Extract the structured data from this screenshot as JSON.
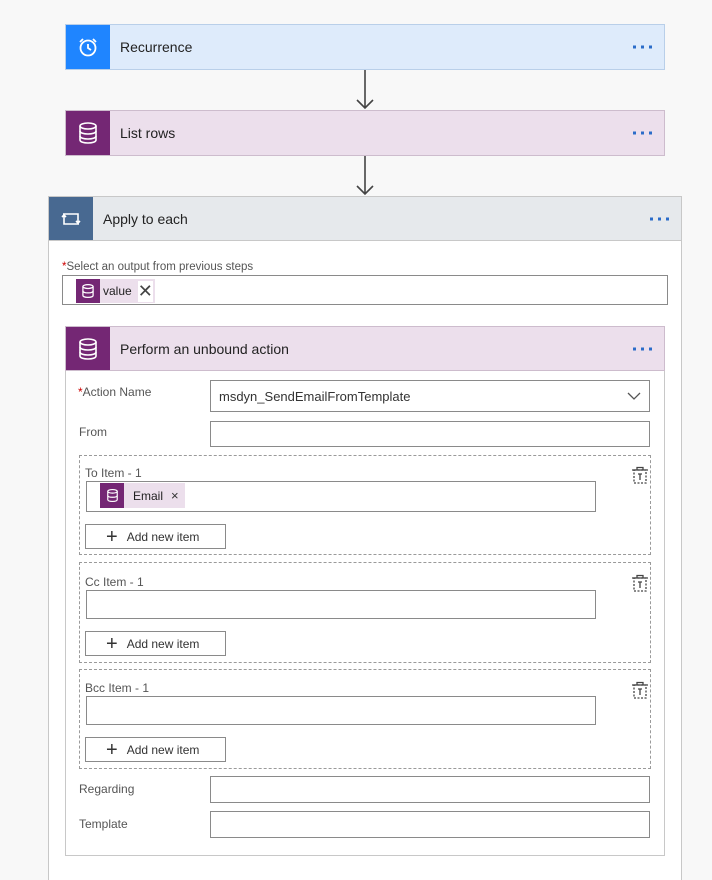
{
  "colors": {
    "recurrence_bg": "#deebfb",
    "recurrence_icon_bg": "#1f85ff",
    "dataverse_bg": "#ecdfec",
    "dataverse_icon_bg": "#742774",
    "loop_bg": "#e6e9ec",
    "loop_icon_bg": "#486991",
    "accent": "#2b6cc9"
  },
  "steps": {
    "recurrence": {
      "title": "Recurrence",
      "icon": "alarm-clock-icon"
    },
    "list_rows": {
      "title": "List rows",
      "icon": "database-icon"
    },
    "apply_to_each": {
      "title": "Apply to each",
      "icon": "loop-icon",
      "select_output_label": "Select an output from previous steps",
      "required_mark": "*",
      "token": {
        "label": "value",
        "icon": "database-icon",
        "remove": "✕"
      }
    },
    "perform_action": {
      "title": "Perform an unbound action",
      "icon": "database-icon",
      "action_name_label": "Action Name",
      "required_mark": "*",
      "action_name_value": "msdyn_SendEmailFromTemplate",
      "from_label": "From",
      "to_item_label": "To Item - 1",
      "to_token": {
        "label": "Email",
        "remove": "×"
      },
      "cc_item_label": "Cc Item - 1",
      "bcc_item_label": "Bcc Item - 1",
      "add_new_item": "Add new item",
      "regarding_label": "Regarding",
      "template_label": "Template"
    }
  }
}
